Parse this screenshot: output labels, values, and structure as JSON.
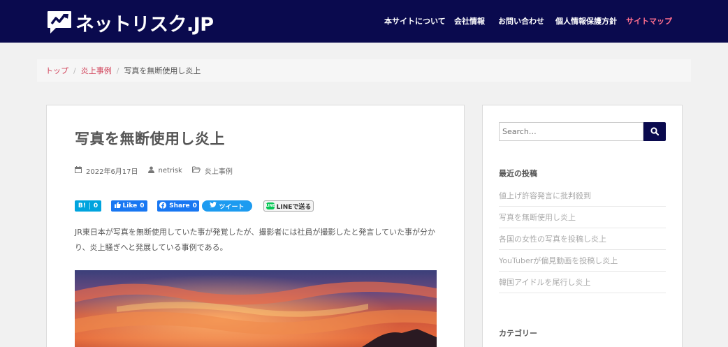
{
  "header": {
    "logo_text": "ネットリスク.JP",
    "nav": [
      {
        "label": "本サイトについて"
      },
      {
        "label": "会社情報"
      },
      {
        "label": "お問い合わせ"
      },
      {
        "label": "個人情報保護方針"
      },
      {
        "label": "サイトマップ",
        "current": true
      }
    ]
  },
  "breadcrumb": {
    "items": [
      "トップ",
      "炎上事例"
    ],
    "separator": "/",
    "current": "写真を無断使用し炎上"
  },
  "post": {
    "title": "写真を無断使用し炎上",
    "date": "2022年6月17日",
    "author": "netrisk",
    "category": "炎上事例",
    "excerpt": "JR東日本が写真を無断使用していた事が発覚したが、撮影者には社員が撮影したと発言していた事が分かり、炎上騒ぎへと発展している事例である。"
  },
  "share": {
    "hatena_label": "B!",
    "hatena_count": "0",
    "like_label": "Like",
    "like_count": "0",
    "fb_label": "Share",
    "fb_count": "0",
    "tweet_label": "ツイート",
    "line_badge": "LINE",
    "line_label": "LINEで送る"
  },
  "sidebar": {
    "search_placeholder": "Search…",
    "recent_title": "最近の投稿",
    "recent_posts": [
      "値上げ許容発言に批判殺到",
      "写真を無断使用し炎上",
      "各国の女性の写真を投稿し炎上",
      "YouTuberが偏見動画を投稿し炎上",
      "韓国アイドルを尾行し炎上"
    ],
    "category_title": "カテゴリー"
  },
  "colors": {
    "header_bg": "#0a0a4e",
    "accent_pink": "#ff6f8e",
    "breadcrumb_link": "#d2455c"
  }
}
